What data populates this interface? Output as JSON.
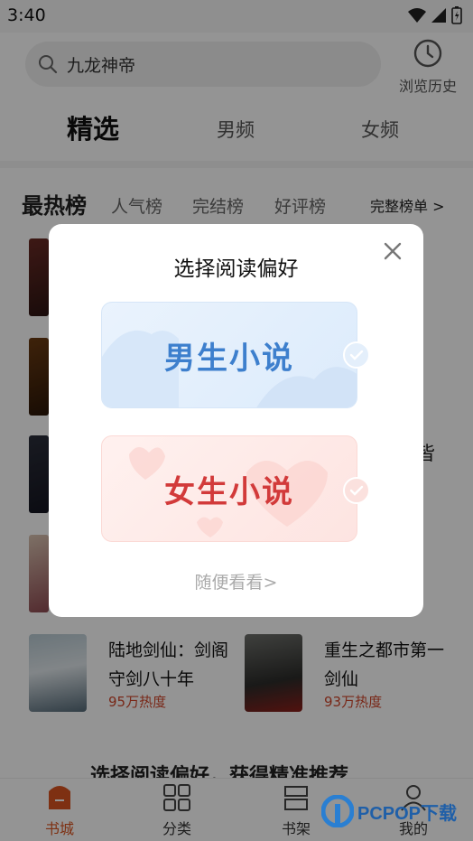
{
  "status": {
    "time": "3:40"
  },
  "search": {
    "text": "九龙神帝",
    "icon": "search-icon"
  },
  "history": {
    "label": "浏览历史",
    "icon": "clock-icon"
  },
  "tabs": [
    {
      "label": "精选",
      "active": true
    },
    {
      "label": "男频",
      "active": false
    },
    {
      "label": "女频",
      "active": false
    }
  ],
  "ranking": {
    "title": "最热榜",
    "tabs": [
      "人气榜",
      "完结榜",
      "好评榜"
    ],
    "all_label": "完整榜单 >"
  },
  "partial_text": "皆",
  "books": [
    {
      "title": "陆地剑仙：剑阁守剑八十年",
      "heat": "95万热度"
    },
    {
      "title": "重生之都市第一剑仙",
      "heat": "93万热度"
    }
  ],
  "promo": "选择阅读偏好，获得精准推荐",
  "nav": [
    {
      "label": "书城",
      "icon": "home-icon",
      "active": true
    },
    {
      "label": "分类",
      "icon": "grid-icon",
      "active": false
    },
    {
      "label": "书架",
      "icon": "shelf-icon",
      "active": false
    },
    {
      "label": "我的",
      "icon": "user-icon",
      "active": false
    }
  ],
  "modal": {
    "title": "选择阅读偏好",
    "male_label": "男生小说",
    "female_label": "女生小说",
    "browse_label": "随便看看>"
  },
  "watermark": {
    "text": "PCPOP下载"
  },
  "colors": {
    "accent": "#d9541f",
    "male": "#3d7fcd",
    "female": "#d23a3a"
  }
}
